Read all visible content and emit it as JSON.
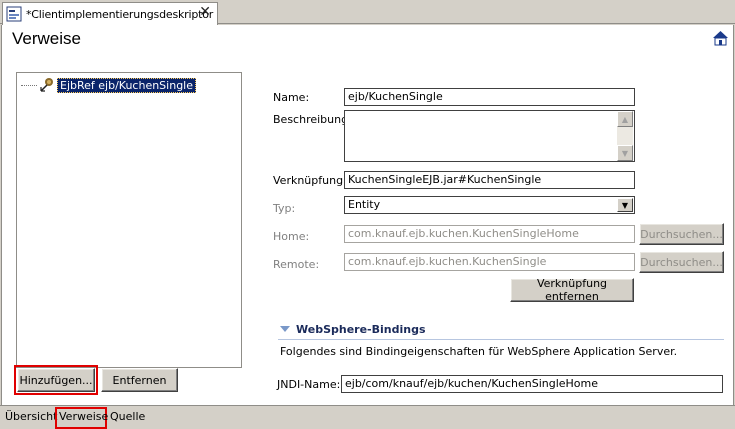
{
  "editor_tab": {
    "label": "*Clientimplementierungsdeskriptor",
    "close": "✕"
  },
  "page": {
    "title": "Verweise"
  },
  "tree": {
    "items": [
      {
        "label": "EjbRef ejb/KuchenSingle"
      }
    ]
  },
  "buttons": {
    "add": "Hinzufügen...",
    "remove": "Entfernen",
    "browse_home": "Durchsuchen...",
    "browse_remote": "Durchsuchen...",
    "remove_link": "Verknüpfung entfernen"
  },
  "details": {
    "name": {
      "label": "Name:",
      "value": "ejb/KuchenSingle"
    },
    "description": {
      "label": "Beschreibung:",
      "value": ""
    },
    "link": {
      "label": "Verknüpfung:",
      "value": "KuchenSingleEJB.jar#KuchenSingle"
    },
    "type": {
      "label": "Typ:",
      "value": "Entity"
    },
    "home": {
      "label": "Home:",
      "value": "com.knauf.ejb.kuchen.KuchenSingleHome"
    },
    "remote": {
      "label": "Remote:",
      "value": "com.knauf.ejb.kuchen.KuchenSingle"
    }
  },
  "websphere": {
    "title": "WebSphere-Bindings",
    "description": "Folgendes sind Bindingeigenschaften für WebSphere Application Server.",
    "jndi": {
      "label": "JNDI-Name:",
      "value": "ejb/com/knauf/ejb/kuchen/KuchenSingleHome"
    }
  },
  "page_tabs": [
    "Übersicht",
    "Verweise",
    "Quelle"
  ],
  "icons": {
    "editor": "deployment-descriptor-icon",
    "home": "home-icon",
    "tree_item": "ejb-reference-icon"
  },
  "colors": {
    "highlight": "#e00000",
    "selection": "#0a246a",
    "section_title": "#1a2a5a"
  }
}
